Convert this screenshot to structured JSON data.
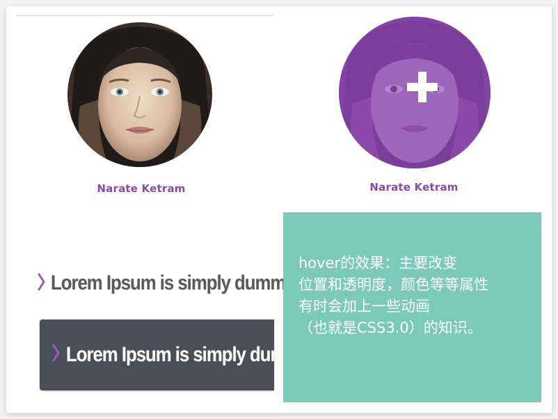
{
  "profiles": {
    "left": {
      "name": "Narate Ketram",
      "state": "normal"
    },
    "right": {
      "name": "Narate Ketram",
      "state": "hover",
      "overlay_color": "#8a49ad",
      "overlay_icon": "plus-icon"
    }
  },
  "menu": {
    "plain_item": {
      "label": "Lorem Ipsum is simply dummy",
      "icon": "chevron-right-icon",
      "accent": "#9b59b6"
    },
    "hover_item": {
      "label": "Lorem Ipsum is simply dummy",
      "icon": "chevron-right-icon",
      "background": "#484f58"
    }
  },
  "note": {
    "background": "#7bcab9",
    "lines": [
      "hover的效果：主要改变",
      "位置和透明度，颜色等等属性",
      "有时会加上一些动画",
      "（也就是CSS3.0）的知识。"
    ]
  },
  "colors": {
    "name_text": "#8a49ad",
    "note_text": "#ffffff"
  }
}
